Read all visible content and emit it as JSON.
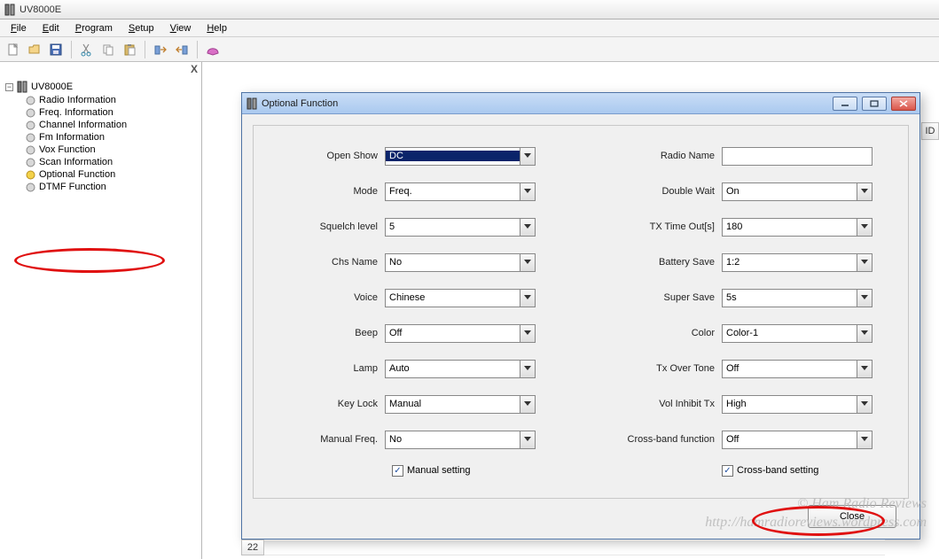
{
  "app": {
    "title": "UV8000E"
  },
  "menu": {
    "file": "File",
    "edit": "Edit",
    "program": "Program",
    "setup": "Setup",
    "view": "View",
    "help": "Help"
  },
  "sidebar": {
    "close": "X",
    "root": "UV8000E",
    "items": [
      "Radio Information",
      "Freq. Information",
      "Channel Information",
      "Fm Information",
      "Vox Function",
      "Scan Information",
      "Optional Function",
      "DTMF Function"
    ]
  },
  "inner_window": {
    "title": "Optional Function",
    "close_label": "Close",
    "left_fields": [
      {
        "label": "Open Show",
        "value": "DC",
        "highlight": true
      },
      {
        "label": "Mode",
        "value": "Freq."
      },
      {
        "label": "Squelch level",
        "value": "5"
      },
      {
        "label": "Chs Name",
        "value": "No"
      },
      {
        "label": "Voice",
        "value": "Chinese"
      },
      {
        "label": "Beep",
        "value": "Off"
      },
      {
        "label": "Lamp",
        "value": "Auto"
      },
      {
        "label": "Key Lock",
        "value": "Manual"
      },
      {
        "label": "Manual Freq.",
        "value": "No"
      }
    ],
    "right_fields": [
      {
        "label": "Radio Name",
        "value": "",
        "text": true
      },
      {
        "label": "Double Wait",
        "value": "On"
      },
      {
        "label": "TX Time Out[s]",
        "value": "180"
      },
      {
        "label": "Battery Save",
        "value": "1:2"
      },
      {
        "label": "Super Save",
        "value": "5s"
      },
      {
        "label": "Color",
        "value": "Color-1"
      },
      {
        "label": "Tx Over Tone",
        "value": "Off"
      },
      {
        "label": "Vol Inhibit Tx",
        "value": "High"
      },
      {
        "label": "Cross-band function",
        "value": "Off"
      }
    ],
    "checkbox_left": "Manual setting",
    "checkbox_right": "Cross-band setting"
  },
  "grid": {
    "header_id": "ID",
    "row_num": "22"
  },
  "watermark": {
    "line1": "© Ham Radio Reviews",
    "line2": "http://hamradioreviews.wordpress.com"
  }
}
